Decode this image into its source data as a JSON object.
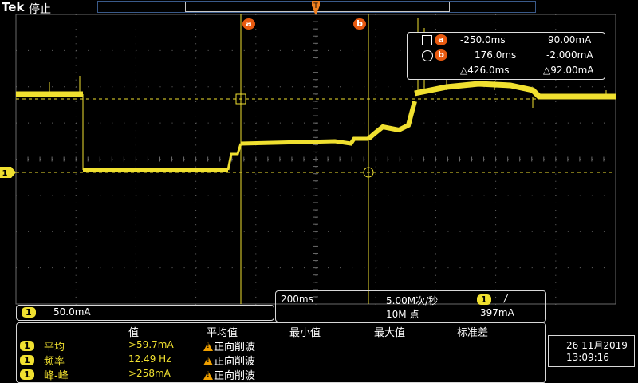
{
  "header": {
    "brand": "Tek",
    "status": "停止",
    "trigger_marker_label": "T"
  },
  "screen": {
    "channel_marker": "1",
    "cursor_a_tag": "a",
    "cursor_b_tag": "b",
    "trace_color": "#f0e030",
    "cursor_color": "#f0e030",
    "grid_color": "#5a5a5a"
  },
  "cursor_readout": {
    "a": {
      "tag": "a",
      "time": "-250.0ms",
      "value": "90.00mA"
    },
    "b": {
      "tag": "b",
      "time": "176.0ms",
      "value": "-2.000mA"
    },
    "delta": {
      "time": "△426.0ms",
      "value": "△92.00mA"
    }
  },
  "vertical_scale": {
    "channel": "1",
    "value": "50.0mA"
  },
  "acquisition": {
    "timebase": "200ms",
    "sample_rate": "5.00M次/秒",
    "record_length": "10M 点",
    "trigger_channel": "1",
    "trigger_slope": "/",
    "trigger_level": "397mA"
  },
  "measurements": {
    "headers": [
      "值",
      "平均值",
      "最小值",
      "最大值",
      "标准差"
    ],
    "rows": [
      {
        "channel": "1",
        "name": "平均",
        "value": ">59.7mA",
        "mean": "正向削波"
      },
      {
        "channel": "1",
        "name": "频率",
        "value": "12.49 Hz",
        "mean": "正向削波"
      },
      {
        "channel": "1",
        "name": "峰-峰",
        "value": ">258mA",
        "mean": "正向削波"
      }
    ]
  },
  "datetime": {
    "date": "26 11月2019",
    "time": "13:09:16"
  }
}
